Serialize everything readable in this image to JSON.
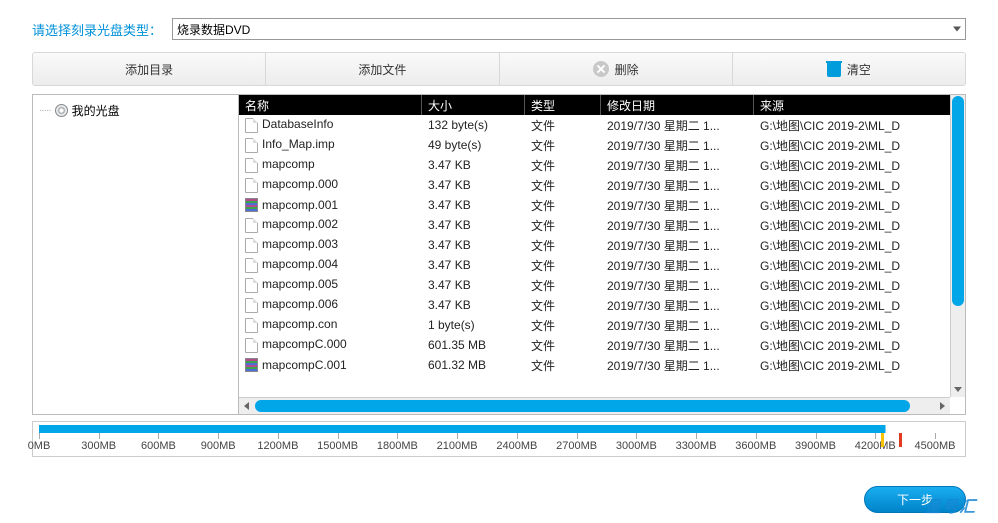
{
  "top": {
    "label": "请选择刻录光盘类型：",
    "selected": "烧录数据DVD"
  },
  "toolbar": {
    "addDir": "添加目录",
    "addFile": "添加文件",
    "delete": "删除",
    "clear": "清空"
  },
  "tree": {
    "root": "我的光盘"
  },
  "columns": {
    "name": "名称",
    "size": "大小",
    "type": "类型",
    "date": "修改日期",
    "source": "来源"
  },
  "files": [
    {
      "icon": "file",
      "name": "DatabaseInfo",
      "size": "132 byte(s)",
      "type": "文件",
      "date": "2019/7/30 星期二 1...",
      "source": "G:\\地图\\CIC 2019-2\\ML_D"
    },
    {
      "icon": "file",
      "name": "Info_Map.imp",
      "size": "49 byte(s)",
      "type": "文件",
      "date": "2019/7/30 星期二 1...",
      "source": "G:\\地图\\CIC 2019-2\\ML_D"
    },
    {
      "icon": "file",
      "name": "mapcomp",
      "size": "3.47 KB",
      "type": "文件",
      "date": "2019/7/30 星期二 1...",
      "source": "G:\\地图\\CIC 2019-2\\ML_D"
    },
    {
      "icon": "file",
      "name": "mapcomp.000",
      "size": "3.47 KB",
      "type": "文件",
      "date": "2019/7/30 星期二 1...",
      "source": "G:\\地图\\CIC 2019-2\\ML_D"
    },
    {
      "icon": "archive",
      "name": "mapcomp.001",
      "size": "3.47 KB",
      "type": "文件",
      "date": "2019/7/30 星期二 1...",
      "source": "G:\\地图\\CIC 2019-2\\ML_D"
    },
    {
      "icon": "file",
      "name": "mapcomp.002",
      "size": "3.47 KB",
      "type": "文件",
      "date": "2019/7/30 星期二 1...",
      "source": "G:\\地图\\CIC 2019-2\\ML_D"
    },
    {
      "icon": "file",
      "name": "mapcomp.003",
      "size": "3.47 KB",
      "type": "文件",
      "date": "2019/7/30 星期二 1...",
      "source": "G:\\地图\\CIC 2019-2\\ML_D"
    },
    {
      "icon": "file",
      "name": "mapcomp.004",
      "size": "3.47 KB",
      "type": "文件",
      "date": "2019/7/30 星期二 1...",
      "source": "G:\\地图\\CIC 2019-2\\ML_D"
    },
    {
      "icon": "file",
      "name": "mapcomp.005",
      "size": "3.47 KB",
      "type": "文件",
      "date": "2019/7/30 星期二 1...",
      "source": "G:\\地图\\CIC 2019-2\\ML_D"
    },
    {
      "icon": "file",
      "name": "mapcomp.006",
      "size": "3.47 KB",
      "type": "文件",
      "date": "2019/7/30 星期二 1...",
      "source": "G:\\地图\\CIC 2019-2\\ML_D"
    },
    {
      "icon": "file",
      "name": "mapcomp.con",
      "size": "1 byte(s)",
      "type": "文件",
      "date": "2019/7/30 星期二 1...",
      "source": "G:\\地图\\CIC 2019-2\\ML_D"
    },
    {
      "icon": "file",
      "name": "mapcompC.000",
      "size": "601.35 MB",
      "type": "文件",
      "date": "2019/7/30 星期二 1...",
      "source": "G:\\地图\\CIC 2019-2\\ML_D"
    },
    {
      "icon": "archive",
      "name": "mapcompC.001",
      "size": "601.32 MB",
      "type": "文件",
      "date": "2019/7/30 星期二 1...",
      "source": "G:\\地图\\CIC 2019-2\\ML_D"
    }
  ],
  "capacity": {
    "ticks": [
      "0MB",
      "300MB",
      "600MB",
      "900MB",
      "1200MB",
      "1500MB",
      "1800MB",
      "2100MB",
      "2400MB",
      "2700MB",
      "3000MB",
      "3300MB",
      "3600MB",
      "3900MB",
      "4200MB",
      "4500MB"
    ]
  },
  "nextBtn": "下一步",
  "watermark": "呈号汇"
}
